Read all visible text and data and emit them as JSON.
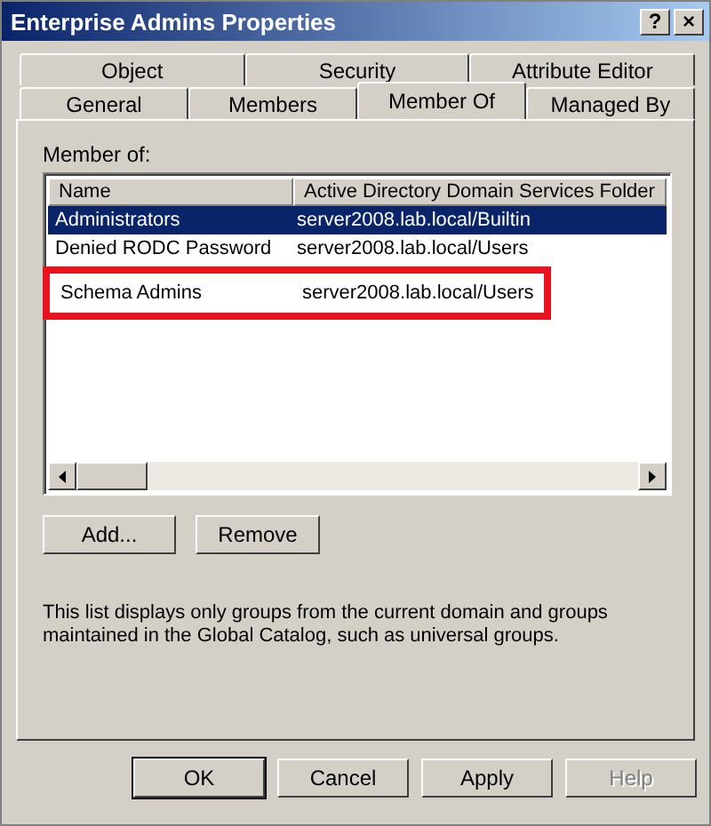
{
  "window": {
    "title": "Enterprise Admins Properties",
    "buttons": [
      "?",
      "×"
    ]
  },
  "tab_rows": [
    {
      "tabs": [
        {
          "label": "Object",
          "selected": false
        },
        {
          "label": "Security",
          "selected": false
        },
        {
          "label": "Attribute Editor",
          "selected": false
        }
      ]
    },
    {
      "tabs": [
        {
          "label": "General",
          "selected": false
        },
        {
          "label": "Members",
          "selected": false
        },
        {
          "label": "Member Of",
          "selected": true
        },
        {
          "label": "Managed By",
          "selected": false
        }
      ]
    }
  ],
  "member_of": {
    "label": "Member of:",
    "columns": [
      "Name",
      "Active Directory Domain Services Folder"
    ],
    "rows": [
      {
        "name": "Administrators",
        "folder": "server2008.lab.local/Builtin",
        "selected": true,
        "highlighted": false
      },
      {
        "name": "Denied RODC Password",
        "folder": "server2008.lab.local/Users",
        "selected": false,
        "highlighted": false
      },
      {
        "name": "Schema Admins",
        "folder": "server2008.lab.local/Users",
        "selected": false,
        "highlighted": true
      }
    ],
    "buttons": [
      "Add...",
      "Remove"
    ],
    "note": "This list displays only groups from the current domain and groups maintained in the Global Catalog, such as universal groups."
  },
  "buttons": [
    {
      "label": "OK",
      "default": true,
      "disabled": false
    },
    {
      "label": "Cancel",
      "default": false,
      "disabled": false
    },
    {
      "label": "Apply",
      "default": false,
      "disabled": false
    },
    {
      "label": "Help",
      "default": false,
      "disabled": true
    }
  ]
}
